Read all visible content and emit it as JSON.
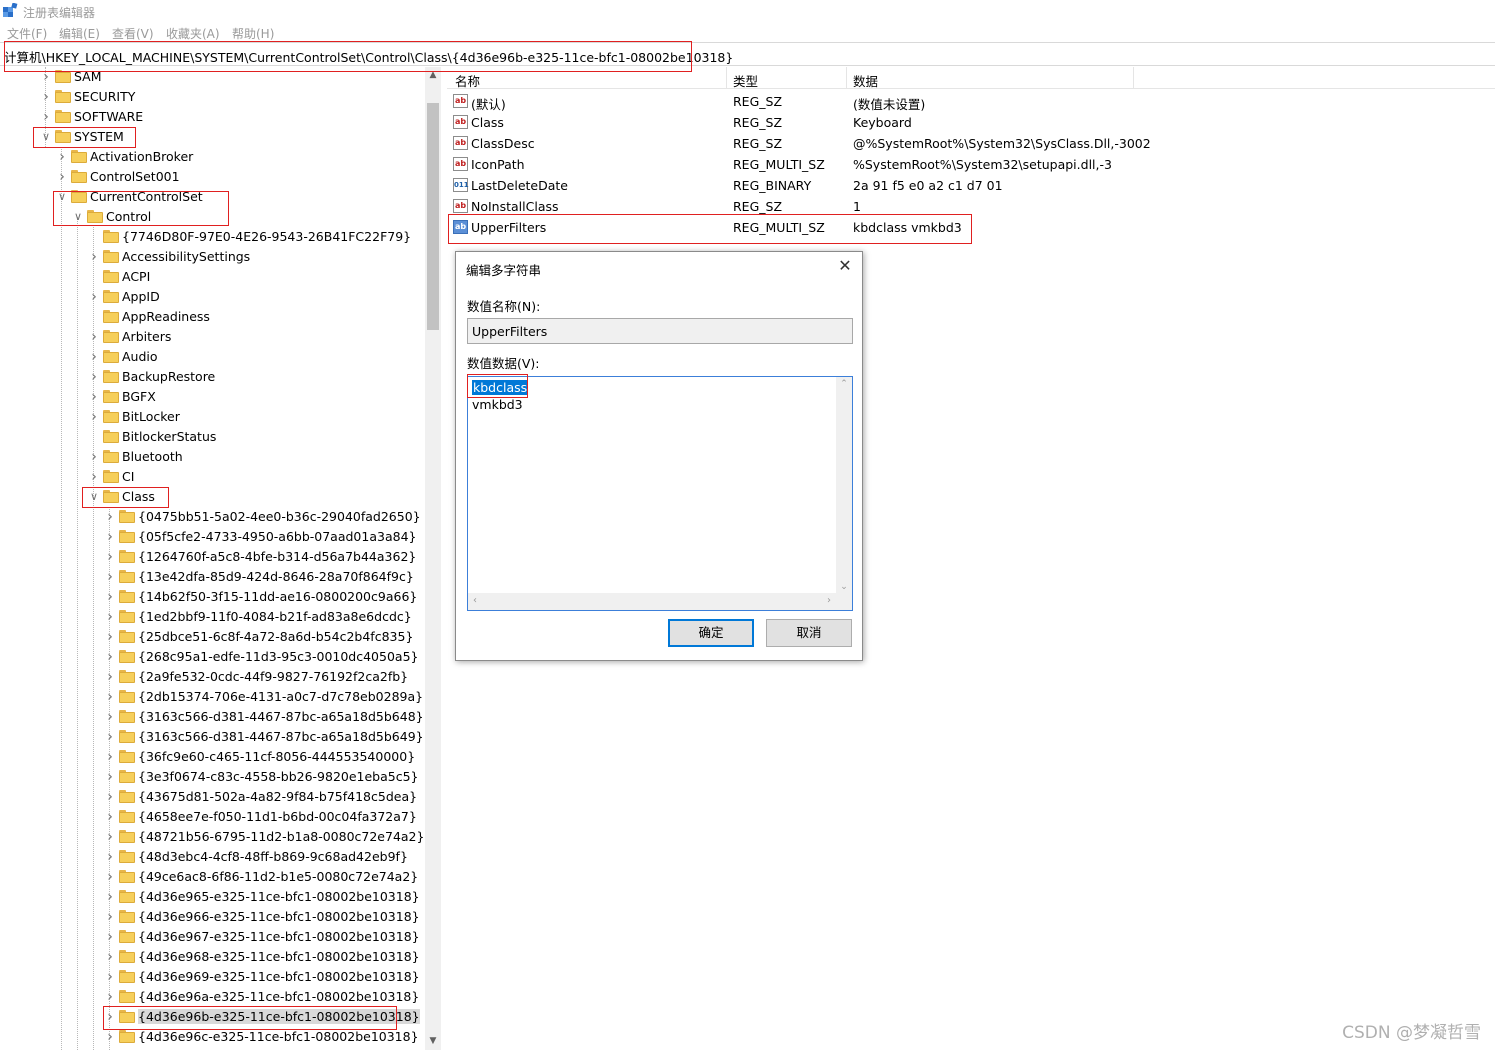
{
  "window": {
    "title": "注册表编辑器"
  },
  "menu": [
    "文件(F)",
    "编辑(E)",
    "查看(V)",
    "收藏夹(A)",
    "帮助(H)"
  ],
  "address": "计算机\\HKEY_LOCAL_MACHINE\\SYSTEM\\CurrentControlSet\\Control\\Class\\{4d36e96b-e325-11ce-bfc1-08002be10318}",
  "tree": [
    {
      "label": "SAM",
      "level": 1,
      "expanded": false
    },
    {
      "label": "SECURITY",
      "level": 1,
      "expanded": false
    },
    {
      "label": "SOFTWARE",
      "level": 1,
      "expanded": false
    },
    {
      "label": "SYSTEM",
      "level": 1,
      "expanded": true
    },
    {
      "label": "ActivationBroker",
      "level": 2,
      "expanded": false
    },
    {
      "label": "ControlSet001",
      "level": 2,
      "expanded": false
    },
    {
      "label": "CurrentControlSet",
      "level": 2,
      "expanded": true
    },
    {
      "label": "Control",
      "level": 3,
      "expanded": true
    },
    {
      "label": "{7746D80F-97E0-4E26-9543-26B41FC22F79}",
      "level": 4,
      "expanded": null
    },
    {
      "label": "AccessibilitySettings",
      "level": 4,
      "expanded": false
    },
    {
      "label": "ACPI",
      "level": 4,
      "expanded": null
    },
    {
      "label": "AppID",
      "level": 4,
      "expanded": false
    },
    {
      "label": "AppReadiness",
      "level": 4,
      "expanded": null
    },
    {
      "label": "Arbiters",
      "level": 4,
      "expanded": false
    },
    {
      "label": "Audio",
      "level": 4,
      "expanded": false
    },
    {
      "label": "BackupRestore",
      "level": 4,
      "expanded": false
    },
    {
      "label": "BGFX",
      "level": 4,
      "expanded": false
    },
    {
      "label": "BitLocker",
      "level": 4,
      "expanded": false
    },
    {
      "label": "BitlockerStatus",
      "level": 4,
      "expanded": null
    },
    {
      "label": "Bluetooth",
      "level": 4,
      "expanded": false
    },
    {
      "label": "CI",
      "level": 4,
      "expanded": false
    },
    {
      "label": "Class",
      "level": 4,
      "expanded": true
    },
    {
      "label": "{0475bb51-5a02-4ee0-b36c-29040fad2650}",
      "level": 5,
      "expanded": false
    },
    {
      "label": "{05f5cfe2-4733-4950-a6bb-07aad01a3a84}",
      "level": 5,
      "expanded": false
    },
    {
      "label": "{1264760f-a5c8-4bfe-b314-d56a7b44a362}",
      "level": 5,
      "expanded": false
    },
    {
      "label": "{13e42dfa-85d9-424d-8646-28a70f864f9c}",
      "level": 5,
      "expanded": false
    },
    {
      "label": "{14b62f50-3f15-11dd-ae16-0800200c9a66}",
      "level": 5,
      "expanded": false
    },
    {
      "label": "{1ed2bbf9-11f0-4084-b21f-ad83a8e6dcdc}",
      "level": 5,
      "expanded": false
    },
    {
      "label": "{25dbce51-6c8f-4a72-8a6d-b54c2b4fc835}",
      "level": 5,
      "expanded": false
    },
    {
      "label": "{268c95a1-edfe-11d3-95c3-0010dc4050a5}",
      "level": 5,
      "expanded": false
    },
    {
      "label": "{2a9fe532-0cdc-44f9-9827-76192f2ca2fb}",
      "level": 5,
      "expanded": false
    },
    {
      "label": "{2db15374-706e-4131-a0c7-d7c78eb0289a}",
      "level": 5,
      "expanded": false
    },
    {
      "label": "{3163c566-d381-4467-87bc-a65a18d5b648}",
      "level": 5,
      "expanded": false
    },
    {
      "label": "{3163c566-d381-4467-87bc-a65a18d5b649}",
      "level": 5,
      "expanded": false
    },
    {
      "label": "{36fc9e60-c465-11cf-8056-444553540000}",
      "level": 5,
      "expanded": false
    },
    {
      "label": "{3e3f0674-c83c-4558-bb26-9820e1eba5c5}",
      "level": 5,
      "expanded": false
    },
    {
      "label": "{43675d81-502a-4a82-9f84-b75f418c5dea}",
      "level": 5,
      "expanded": false
    },
    {
      "label": "{4658ee7e-f050-11d1-b6bd-00c04fa372a7}",
      "level": 5,
      "expanded": false
    },
    {
      "label": "{48721b56-6795-11d2-b1a8-0080c72e74a2}",
      "level": 5,
      "expanded": false
    },
    {
      "label": "{48d3ebc4-4cf8-48ff-b869-9c68ad42eb9f}",
      "level": 5,
      "expanded": false
    },
    {
      "label": "{49ce6ac8-6f86-11d2-b1e5-0080c72e74a2}",
      "level": 5,
      "expanded": false
    },
    {
      "label": "{4d36e965-e325-11ce-bfc1-08002be10318}",
      "level": 5,
      "expanded": false
    },
    {
      "label": "{4d36e966-e325-11ce-bfc1-08002be10318}",
      "level": 5,
      "expanded": false
    },
    {
      "label": "{4d36e967-e325-11ce-bfc1-08002be10318}",
      "level": 5,
      "expanded": false
    },
    {
      "label": "{4d36e968-e325-11ce-bfc1-08002be10318}",
      "level": 5,
      "expanded": false
    },
    {
      "label": "{4d36e969-e325-11ce-bfc1-08002be10318}",
      "level": 5,
      "expanded": false
    },
    {
      "label": "{4d36e96a-e325-11ce-bfc1-08002be10318}",
      "level": 5,
      "expanded": false
    },
    {
      "label": "{4d36e96b-e325-11ce-bfc1-08002be10318}",
      "level": 5,
      "expanded": false,
      "selected": true
    },
    {
      "label": "{4d36e96c-e325-11ce-bfc1-08002be10318}",
      "level": 5,
      "expanded": false
    }
  ],
  "list": {
    "headers": {
      "name": "名称",
      "type": "类型",
      "data": "数据"
    },
    "rows": [
      {
        "name": "(默认)",
        "type": "REG_SZ",
        "data": "(数值未设置)",
        "icon": "string-value-icon"
      },
      {
        "name": "Class",
        "type": "REG_SZ",
        "data": "Keyboard",
        "icon": "string-value-icon"
      },
      {
        "name": "ClassDesc",
        "type": "REG_SZ",
        "data": "@%SystemRoot%\\System32\\SysClass.Dll,-3002",
        "icon": "string-value-icon"
      },
      {
        "name": "IconPath",
        "type": "REG_MULTI_SZ",
        "data": "%SystemRoot%\\System32\\setupapi.dll,-3",
        "icon": "string-value-icon"
      },
      {
        "name": "LastDeleteDate",
        "type": "REG_BINARY",
        "data": "2a 91 f5 e0 a2 c1 d7 01",
        "icon": "binary-value-icon"
      },
      {
        "name": "NoInstallClass",
        "type": "REG_SZ",
        "data": "1",
        "icon": "string-value-icon"
      },
      {
        "name": "UpperFilters",
        "type": "REG_MULTI_SZ",
        "data": "kbdclass vmkbd3",
        "icon": "string-value-icon",
        "highlighted": true
      }
    ]
  },
  "dialog": {
    "title": "编辑多字符串",
    "name_label": "数值名称(N):",
    "name_value": "UpperFilters",
    "data_label": "数值数据(V):",
    "data_lines": [
      "kbdclass",
      "vmkbd3"
    ],
    "ok": "确定",
    "cancel": "取消"
  },
  "watermark": "CSDN @梦凝哲雪",
  "colors": {
    "highlight_box": "#e02020",
    "selection": "#0078d7",
    "folder": "#f6cf5b"
  }
}
